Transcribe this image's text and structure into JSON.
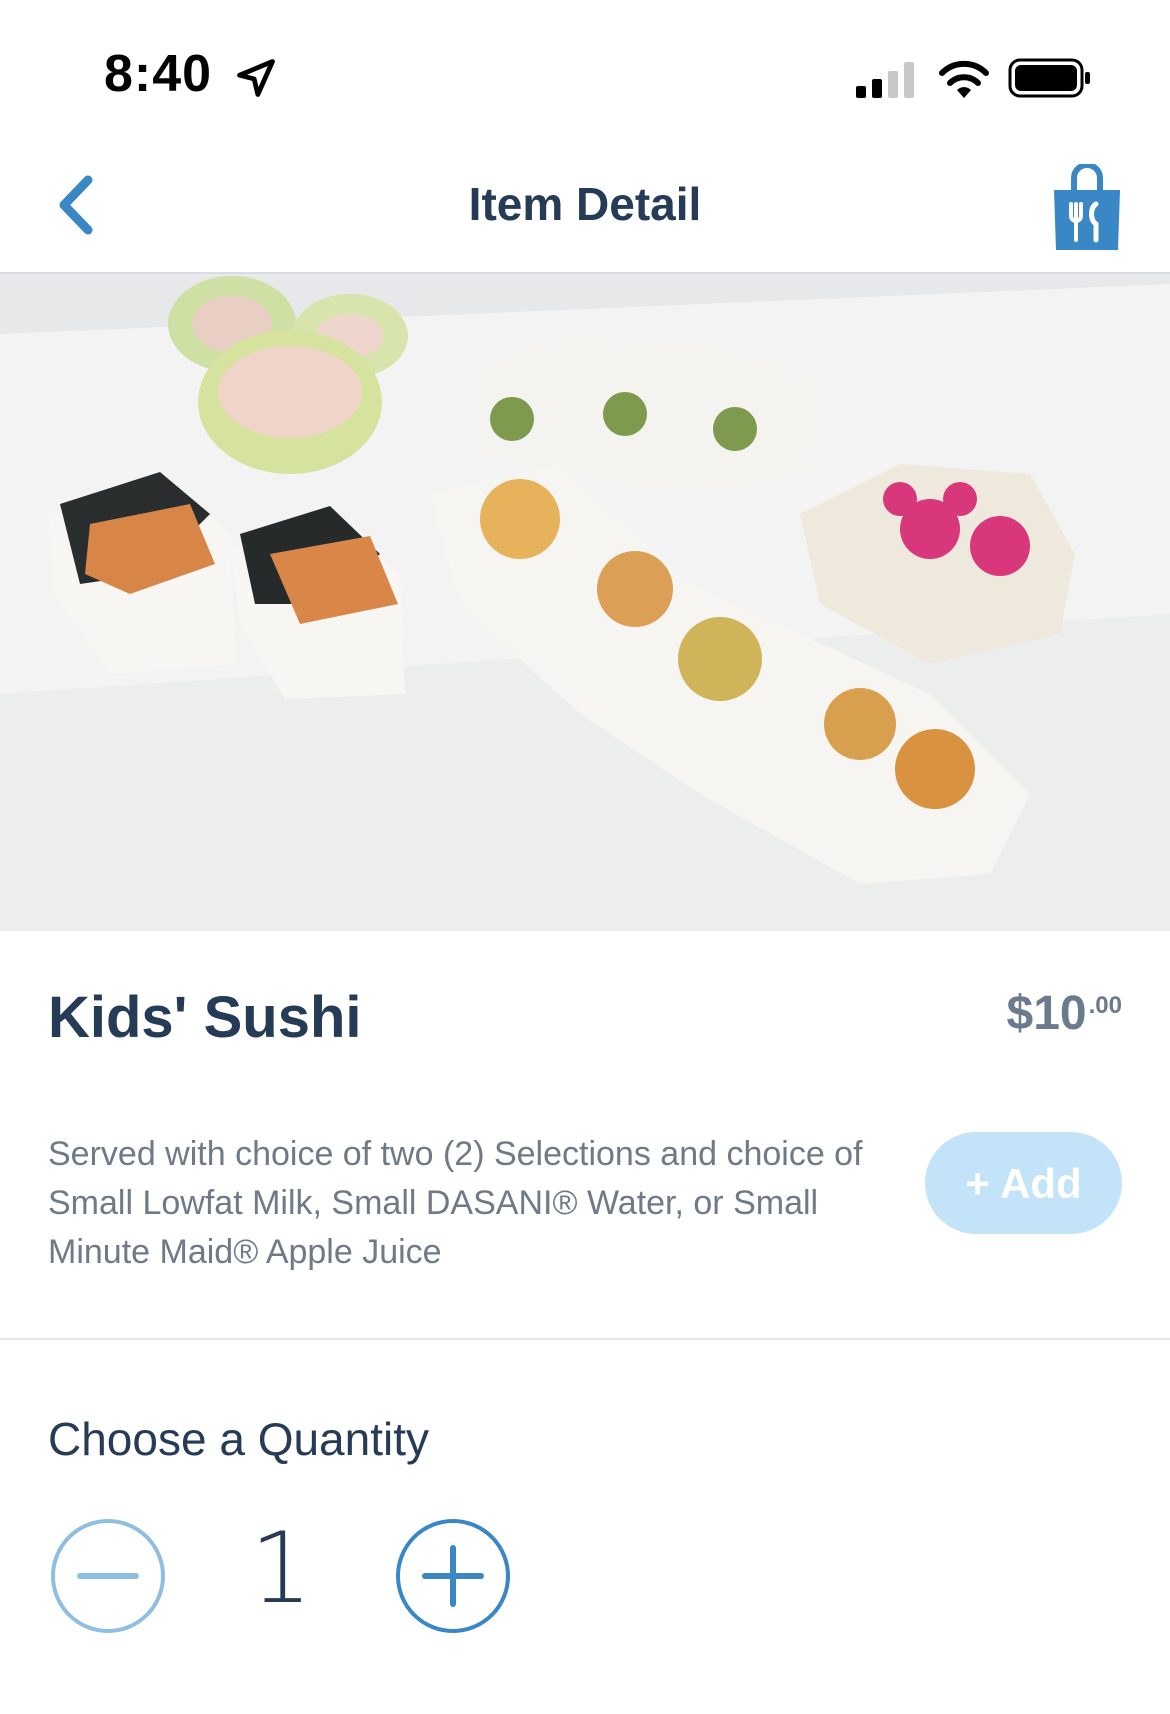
{
  "status_bar": {
    "time": "8:40"
  },
  "nav": {
    "title": "Item Detail",
    "back_icon": "chevron-left-icon",
    "bag_icon": "shopping-bag-fork-knife-icon"
  },
  "item": {
    "title": "Kids' Sushi",
    "price_dollars": "$10",
    "price_cents": ".00",
    "description": "Served with choice of two (2) Selections and choice of Small Lowfat Milk, Small DASANI® Water, or Small Minute Maid® Apple Juice",
    "add_label": "+ Add"
  },
  "quantity": {
    "label": "Choose a Quantity",
    "value": "1"
  },
  "colors": {
    "accent": "#3a87c6",
    "title": "#253b56",
    "add_button": "#c3e3f8",
    "muted": "#6e7a87"
  }
}
